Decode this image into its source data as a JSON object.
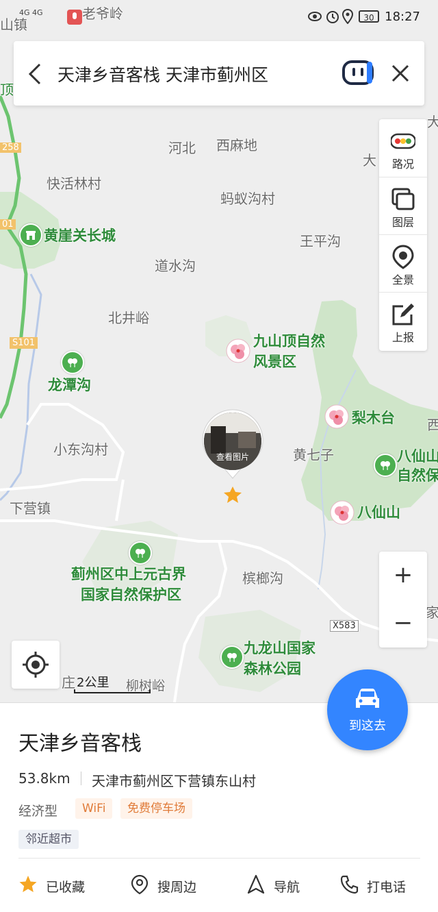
{
  "status_bar": {
    "network": "4G 4G",
    "corner_label": "山镇",
    "top_label": "老爷岭",
    "battery": "30",
    "time": "18:27"
  },
  "search": {
    "query": "天津乡音客栈 天津市蓟州区"
  },
  "tools": {
    "traffic": "路况",
    "layers": "图层",
    "panorama": "全景",
    "report": "上报"
  },
  "map": {
    "labels": {
      "hebei": "河北",
      "ximadi": "西麻地",
      "kuaihuolin": "快活林村",
      "mayigou": "蚂蚁沟村",
      "wangpinggou": "王平沟",
      "huangyaguan": "黄崖关长城",
      "daoshuigou": "道水沟",
      "beijingyu": "北井峪",
      "jiushanding_1": "九山顶自然",
      "jiushanding_2": "风景区",
      "limutai": "梨木台",
      "longtangou": "龙潭沟",
      "xiaodonggou": "小东沟村",
      "huangqizi": "黄七子",
      "baxianshan_r1": "八仙山",
      "baxianshan_r2": "自然保",
      "baxianshan": "八仙山",
      "xiayingzhen": "下营镇",
      "zhongshangyuan_1": "蓟州区中上元古界",
      "zhongshangyuan_2": "国家自然保护区",
      "binlanggou": "槟榔沟",
      "jiulongshan_1": "九龙山国家",
      "jiulongshan_2": "森林公园",
      "liushuyu": "柳树峪",
      "zhuang": "庄",
      "da": "大",
      "da2": "大",
      "xi": "西",
      "jia": "家",
      "ding": "顶"
    },
    "roads": {
      "r258": "258",
      "s101": "S101",
      "x583": "X583",
      "r01": "01"
    },
    "pin_caption": "查看图片",
    "scale": "2公里",
    "zoom_in": "+",
    "zoom_out": "−"
  },
  "go_button": "到这去",
  "place": {
    "name": "天津乡音客栈",
    "distance": "53.8km",
    "address": "天津市蓟州区下营镇东山村",
    "type": "经济型",
    "tags": [
      "WiFi",
      "免费停车场"
    ],
    "nearby": "邻近超市"
  },
  "actions": {
    "favorite": "已收藏",
    "around": "搜周边",
    "navigate": "导航",
    "call": "打电话"
  },
  "colors": {
    "accent": "#3385ff",
    "green_area": "#cfe5c9",
    "label_green": "#2e8b3a",
    "tag_orange": "#e07b39",
    "star": "#f5a623"
  }
}
